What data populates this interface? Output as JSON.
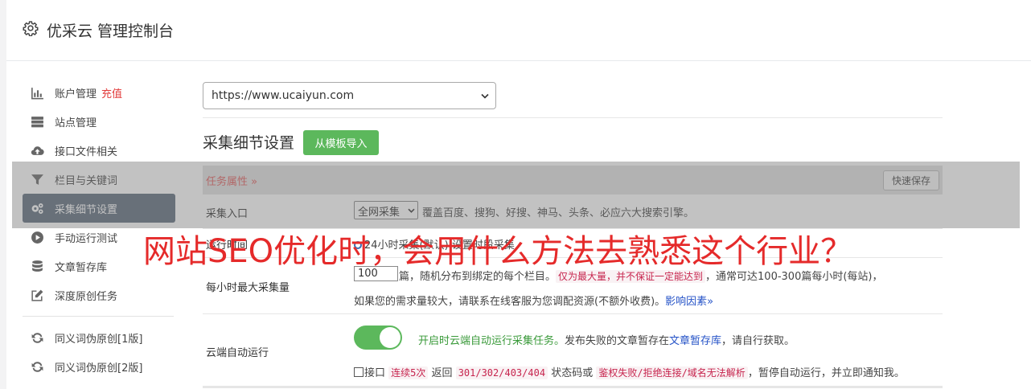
{
  "header": {
    "title": "优采云 管理控制台",
    "icon": "gear-icon"
  },
  "sidebar": {
    "items": [
      {
        "label": "账户管理",
        "accent": "充值",
        "icon": "bar-chart-icon"
      },
      {
        "label": "站点管理",
        "icon": "server-icon"
      },
      {
        "label": "接口文件相关",
        "icon": "cloud-upload-icon"
      },
      {
        "label": "栏目与关键词",
        "icon": "filter-icon"
      },
      {
        "label": "采集细节设置",
        "icon": "gears-icon",
        "active": true
      },
      {
        "label": "手动运行测试",
        "icon": "play-circle-icon"
      },
      {
        "label": "文章暂存库",
        "icon": "database-icon"
      },
      {
        "label": "深度原创任务",
        "icon": "edit-icon"
      },
      {
        "label": "同义词伪原创[1版]",
        "icon": "refresh-icon"
      },
      {
        "label": "同义词伪原创[2版]",
        "icon": "refresh-icon"
      }
    ]
  },
  "site_select": {
    "value": "https://www.ucaiyun.com"
  },
  "section": {
    "title": "采集细节设置",
    "import_label": "从模板导入"
  },
  "tab": {
    "label": "任务属性 »",
    "quick_save": "快速保存"
  },
  "rows": {
    "entry": {
      "label": "采集入口",
      "select_value": "全网采集",
      "desc": "覆盖百度、搜狗、好搜、神马、头条、必应六大搜索引擎。"
    },
    "runtime": {
      "label": "运行时间",
      "text": "24小时采集(默认) 设置时段采集"
    },
    "max": {
      "label": "每小时最大采集量",
      "value": "100",
      "text1": "篇，随机分布到绑定的每个栏目。",
      "code1": "仅为最大量，并不保证一定能达到",
      "text2": "，通常可达100-300篇每小时(每站)，",
      "text3": "如果您的需求量较大，请联系在线客服为您调配资源(不额外收费)。",
      "link": "影响因素»"
    },
    "cloud": {
      "label": "云端自动运行",
      "green_text": "开启时云端自动运行采集任务。",
      "text1": "发布失败的文章暂存在",
      "link": "文章暂存库",
      "text2": "，请自行获取。",
      "cb_label": "接口",
      "code1": "连续5次",
      "text3": "返回",
      "code2": "301/302/403/404",
      "text4": "状态码或",
      "code3": "鉴权失败/拒绝连接/域名无法解析",
      "text5": "，暂停自动运行，并立即通知我。"
    }
  },
  "overlay_title": "网站SEO优化时，会用什么方法去熟悉这个行业？",
  "colors": {
    "accent_green": "#5cb85c",
    "active_bg": "#5b6a7b",
    "title_red": "#e52a2a"
  }
}
